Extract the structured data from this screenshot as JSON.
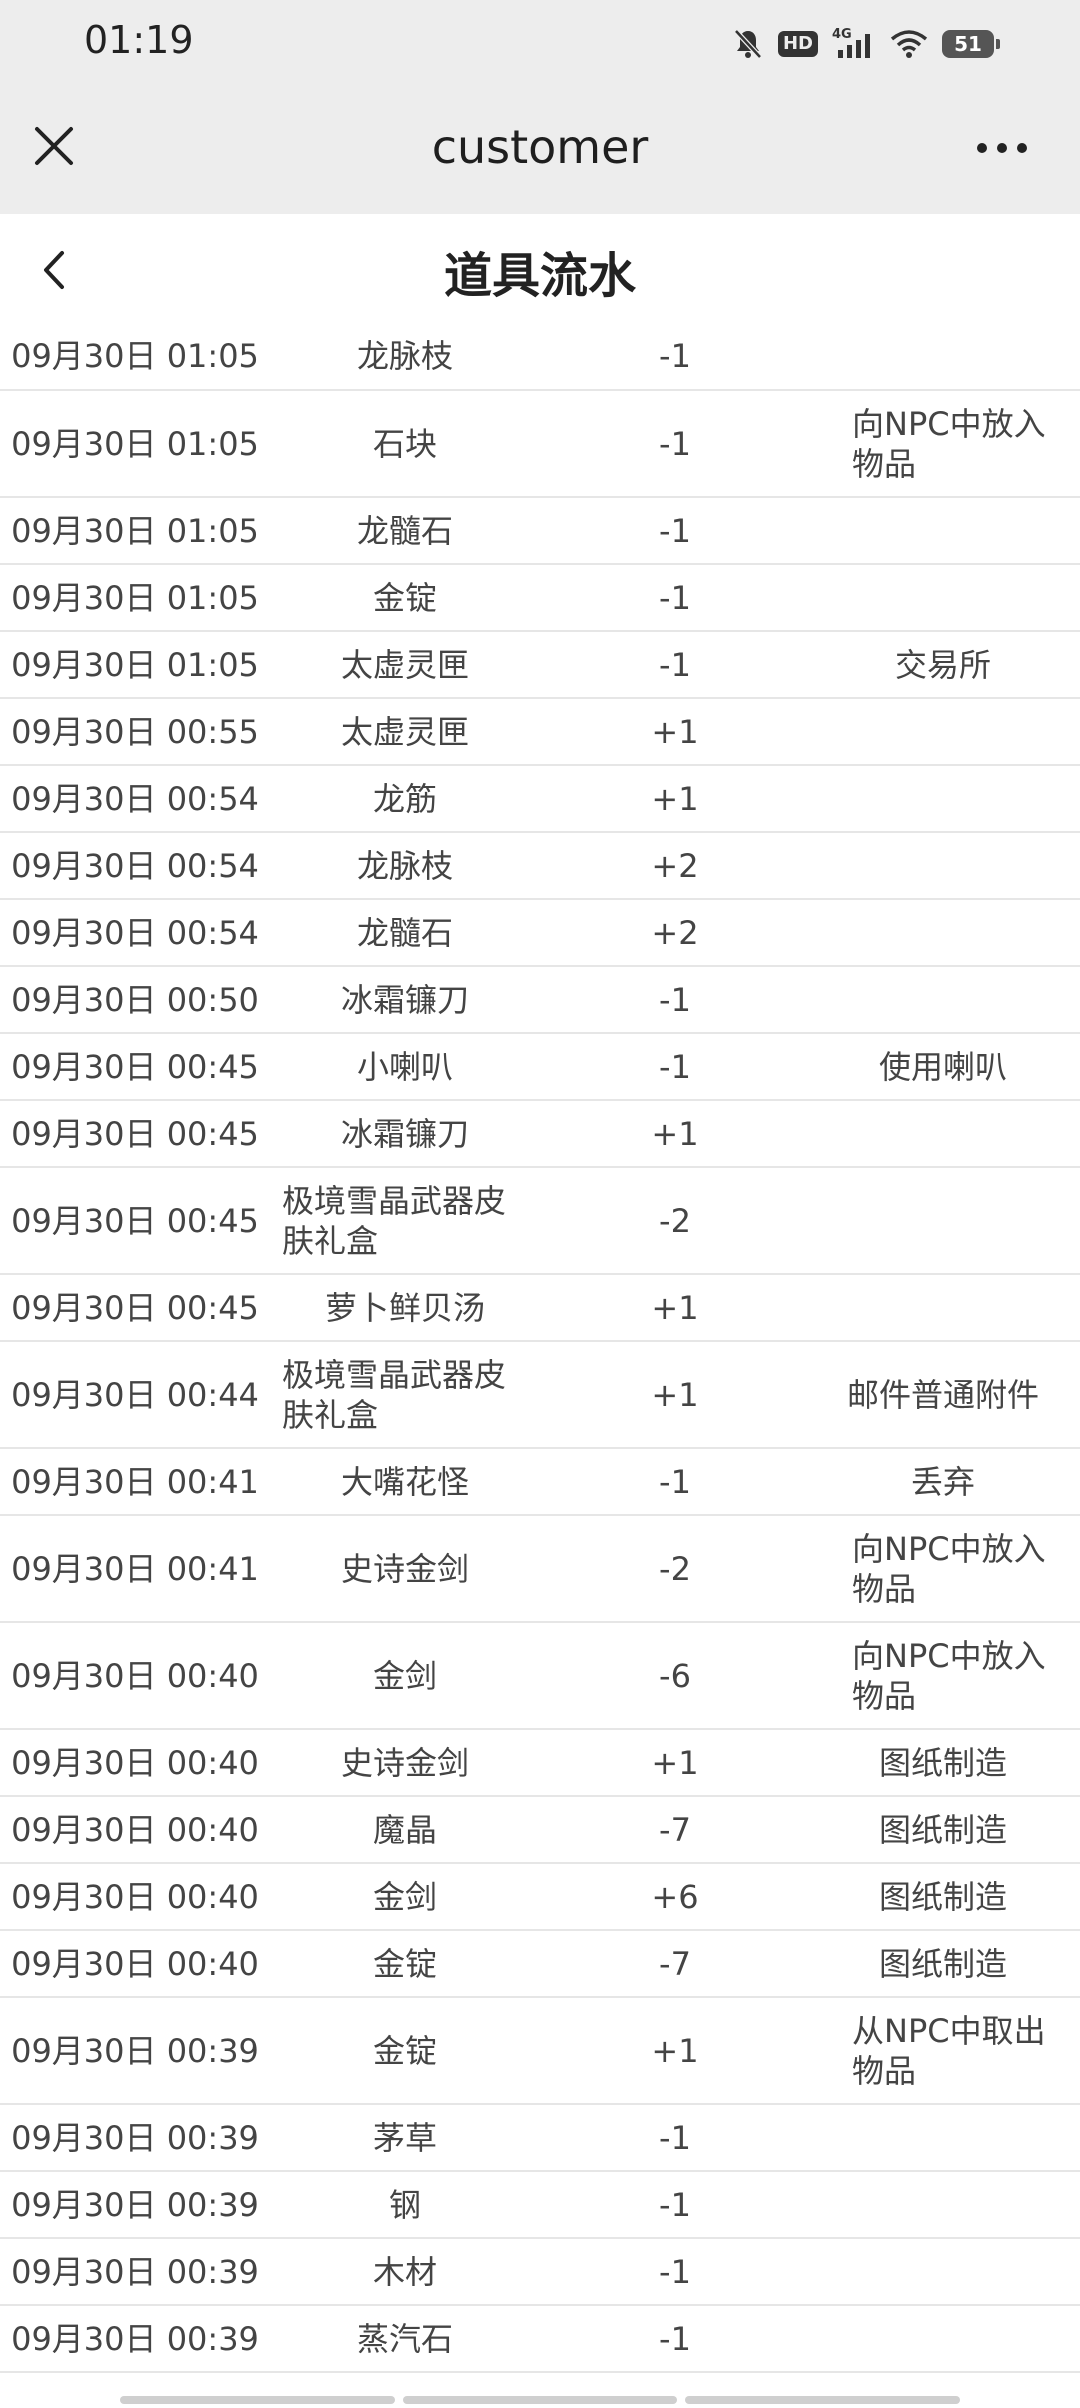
{
  "status_bar": {
    "time": "01:19",
    "hd_label": "HD",
    "network_label": "4G",
    "battery": "51",
    "icons": [
      "bell-off-icon",
      "hd-icon",
      "signal-icon",
      "wifi-icon",
      "battery-icon"
    ]
  },
  "nav": {
    "title": "customer",
    "close_icon": "close-icon",
    "more_icon": "more-icon"
  },
  "page": {
    "title": "道具流水",
    "back_icon": "chevron-left-icon"
  },
  "records": [
    {
      "time": "09月30日 01:05",
      "item": "龙脉枝",
      "qty": "-1",
      "source": ""
    },
    {
      "time": "09月30日 01:05",
      "item": "石块",
      "qty": "-1",
      "source": "向NPC中放入物品"
    },
    {
      "time": "09月30日 01:05",
      "item": "龙髓石",
      "qty": "-1",
      "source": ""
    },
    {
      "time": "09月30日 01:05",
      "item": "金锭",
      "qty": "-1",
      "source": ""
    },
    {
      "time": "09月30日 01:05",
      "item": "太虚灵匣",
      "qty": "-1",
      "source": "交易所"
    },
    {
      "time": "09月30日 00:55",
      "item": "太虚灵匣",
      "qty": "+1",
      "source": ""
    },
    {
      "time": "09月30日 00:54",
      "item": "龙筋",
      "qty": "+1",
      "source": ""
    },
    {
      "time": "09月30日 00:54",
      "item": "龙脉枝",
      "qty": "+2",
      "source": ""
    },
    {
      "time": "09月30日 00:54",
      "item": "龙髓石",
      "qty": "+2",
      "source": ""
    },
    {
      "time": "09月30日 00:50",
      "item": "冰霜镰刀",
      "qty": "-1",
      "source": ""
    },
    {
      "time": "09月30日 00:45",
      "item": "小喇叭",
      "qty": "-1",
      "source": "使用喇叭"
    },
    {
      "time": "09月30日 00:45",
      "item": "冰霜镰刀",
      "qty": "+1",
      "source": ""
    },
    {
      "time": "09月30日 00:45",
      "item": "极境雪晶武器皮肤礼盒",
      "qty": "-2",
      "source": ""
    },
    {
      "time": "09月30日 00:45",
      "item": "萝卜鲜贝汤",
      "qty": "+1",
      "source": ""
    },
    {
      "time": "09月30日 00:44",
      "item": "极境雪晶武器皮肤礼盒",
      "qty": "+1",
      "source": "邮件普通附件"
    },
    {
      "time": "09月30日 00:41",
      "item": "大嘴花怪",
      "qty": "-1",
      "source": "丢弃"
    },
    {
      "time": "09月30日 00:41",
      "item": "史诗金剑",
      "qty": "-2",
      "source": "向NPC中放入物品"
    },
    {
      "time": "09月30日 00:40",
      "item": "金剑",
      "qty": "-6",
      "source": "向NPC中放入物品"
    },
    {
      "time": "09月30日 00:40",
      "item": "史诗金剑",
      "qty": "+1",
      "source": "图纸制造"
    },
    {
      "time": "09月30日 00:40",
      "item": "魔晶",
      "qty": "-7",
      "source": "图纸制造"
    },
    {
      "time": "09月30日 00:40",
      "item": "金剑",
      "qty": "+6",
      "source": "图纸制造"
    },
    {
      "time": "09月30日 00:40",
      "item": "金锭",
      "qty": "-7",
      "source": "图纸制造"
    },
    {
      "time": "09月30日 00:39",
      "item": "金锭",
      "qty": "+1",
      "source": "从NPC中取出物品"
    },
    {
      "time": "09月30日 00:39",
      "item": "茅草",
      "qty": "-1",
      "source": ""
    },
    {
      "time": "09月30日 00:39",
      "item": "钢",
      "qty": "-1",
      "source": ""
    },
    {
      "time": "09月30日 00:39",
      "item": "木材",
      "qty": "-1",
      "source": ""
    },
    {
      "time": "09月30日 00:39",
      "item": "蒸汽石",
      "qty": "-1",
      "source": ""
    }
  ]
}
